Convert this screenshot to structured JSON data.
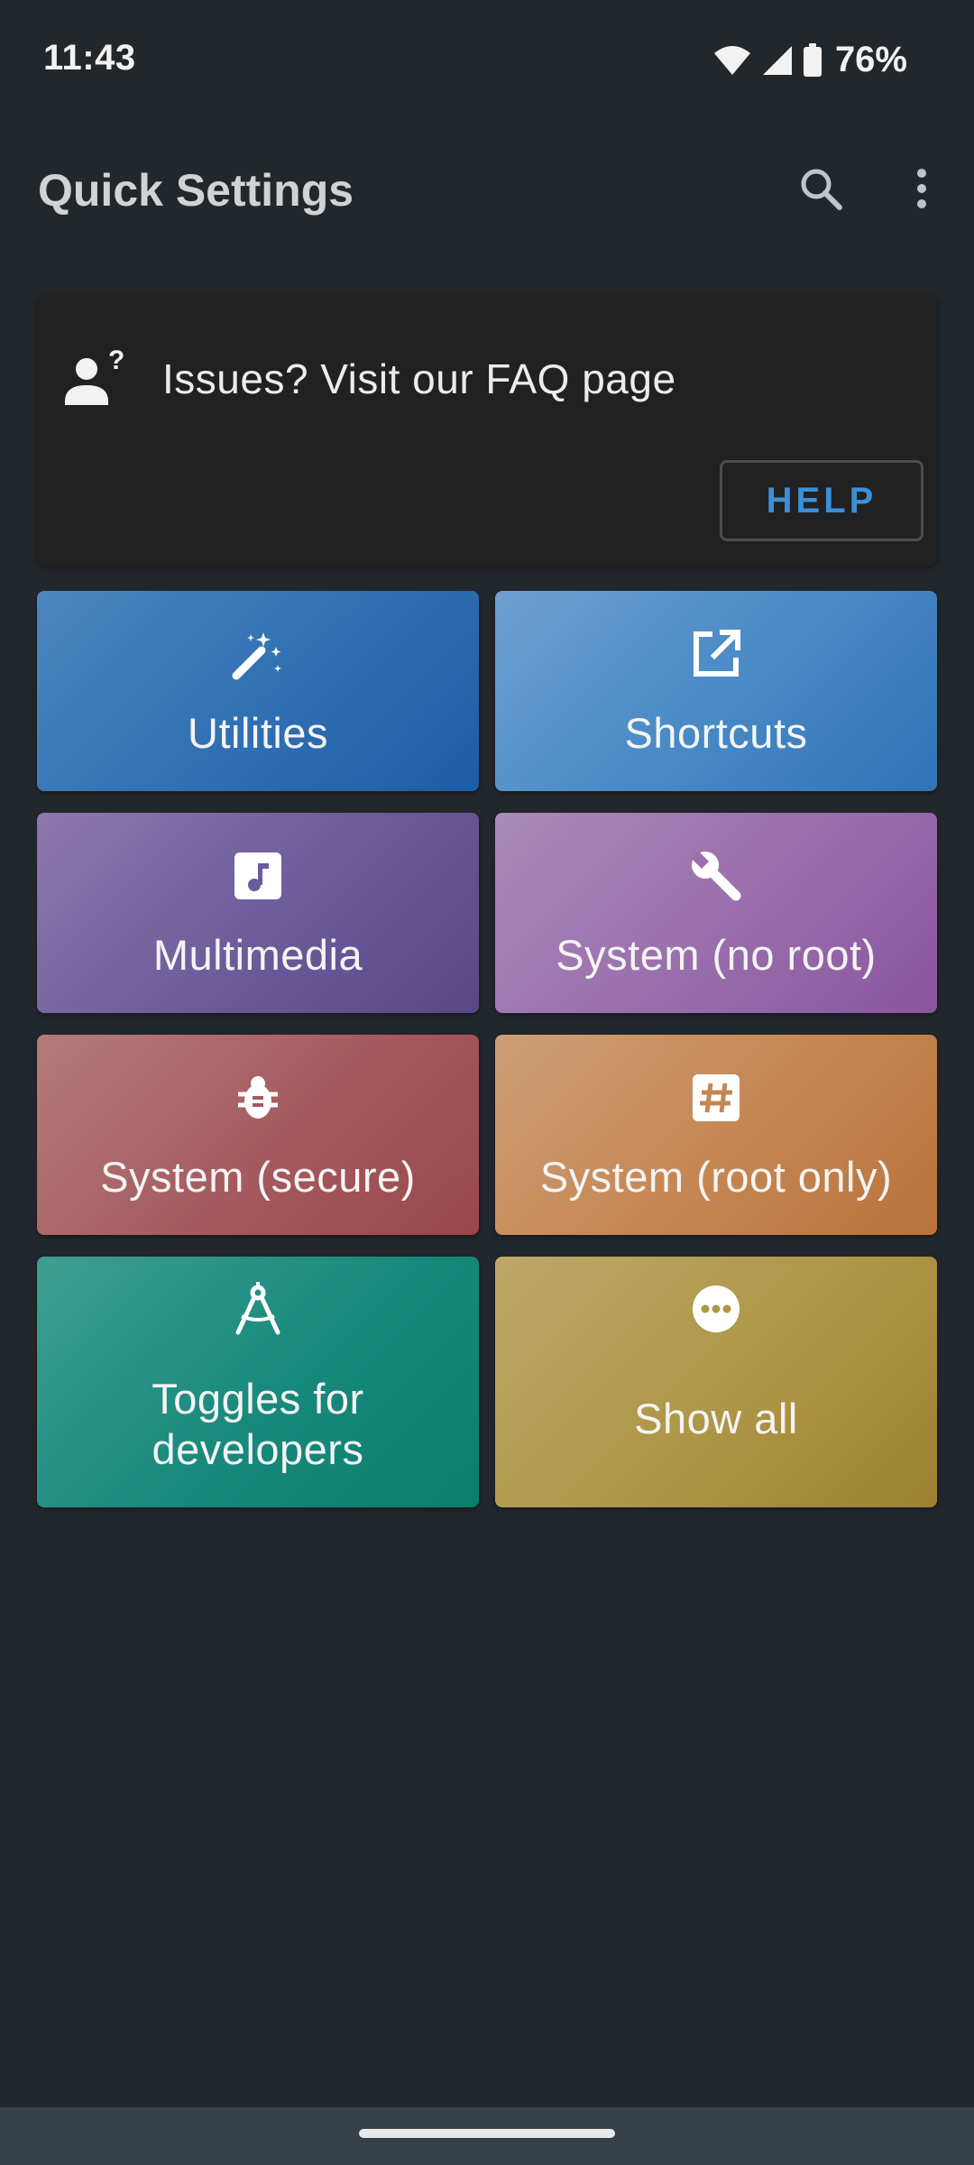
{
  "status_bar": {
    "time": "11:43",
    "battery_percent": "76%",
    "icons": [
      "wifi-icon",
      "signal-icon",
      "battery-icon"
    ]
  },
  "app_bar": {
    "title": "Quick Settings",
    "actions": [
      "search-icon",
      "more-vert-icon"
    ]
  },
  "faq_card": {
    "icon": "person-question-icon",
    "text": "Issues? Visit our FAQ page",
    "button_label": "HELP",
    "button_color": "#3d8fd8"
  },
  "tiles": [
    {
      "label": "Utilities",
      "icon": "magic-wand-icon",
      "color": "#2f6fb2"
    },
    {
      "label": "Shortcuts",
      "icon": "open-in-new-icon",
      "color": "#4a8ac7"
    },
    {
      "label": "Multimedia",
      "icon": "music-note-icon",
      "color": "#6c5b9a"
    },
    {
      "label": "System (no root)",
      "icon": "wrench-icon",
      "color": "#9a70ad"
    },
    {
      "label": "System (secure)",
      "icon": "bug-icon",
      "color": "#a45a5e"
    },
    {
      "label": "System (root only)",
      "icon": "hash-icon",
      "color": "#c48652"
    },
    {
      "label_line1": "Toggles for",
      "label_line2": "developers",
      "icon": "compass-icon",
      "color": "#17897c"
    },
    {
      "label": "Show all",
      "icon": "more-horiz-circle-icon",
      "color": "#ad9646"
    }
  ],
  "colors": {
    "background": "#22272b",
    "card": "#212121",
    "nav_bar": "#394148"
  }
}
